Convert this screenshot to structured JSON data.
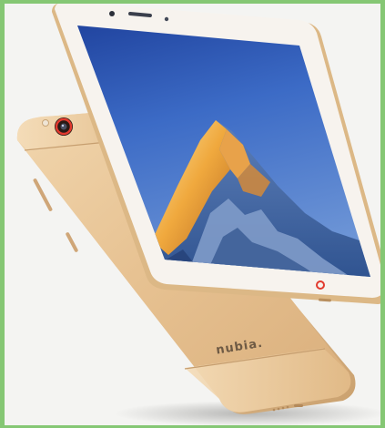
{
  "image": {
    "subject": "smartphone-product-photo",
    "border_color": "#85c774",
    "background_color": "#f4f4f2",
    "phone_color": "#e9c89c",
    "front_bezel_color": "#f7f3ee",
    "accent_ring_color": "#e23a2e"
  },
  "brand": {
    "logo_text": "nubia."
  }
}
